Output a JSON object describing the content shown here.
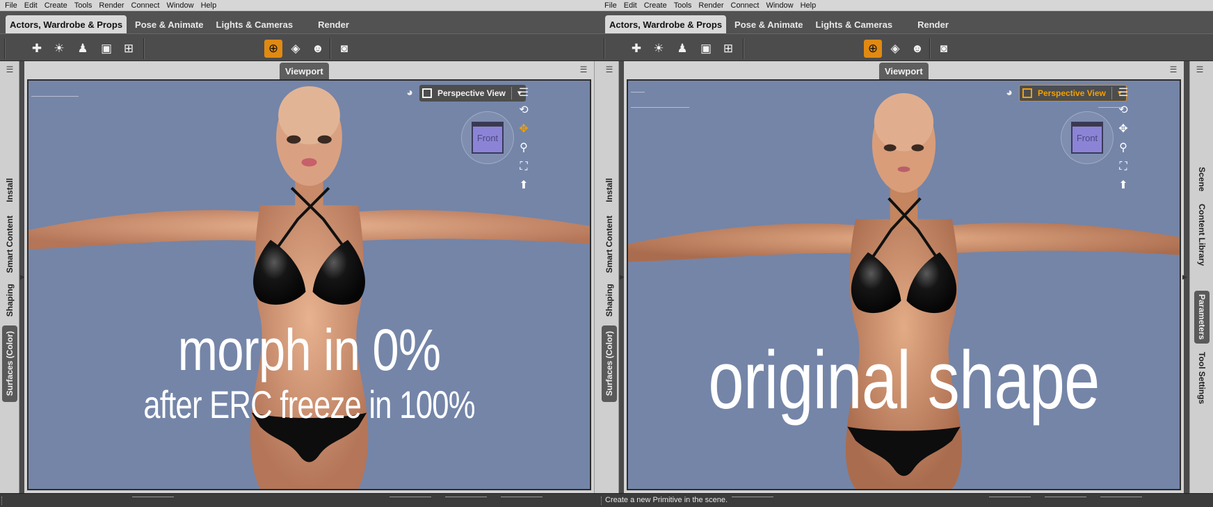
{
  "menu": [
    "File",
    "Edit",
    "Create",
    "Tools",
    "Render",
    "Connect",
    "Window",
    "Help"
  ],
  "tabs": [
    {
      "label": "Actors, Wardrobe & Props",
      "active": true
    },
    {
      "label": "Pose & Animate",
      "active": false
    },
    {
      "label": "Lights & Cameras",
      "active": false
    },
    {
      "label": "Render",
      "active": false
    }
  ],
  "toolbar_icons": [
    "create-primitive-icon",
    "create-light-icon",
    "create-figure-icon",
    "create-camera-icon",
    "create-null-icon",
    "universal-tool-icon",
    "surface-selection-icon",
    "node-weight-brush-icon",
    "render-camera-icon"
  ],
  "viewport_tab": "Viewport",
  "view_dropdown": "Perspective View",
  "cube_label": "Front",
  "left_sidebar_tabs": [
    "Install",
    "Smart Content",
    "Shaping",
    "Surfaces (Color)"
  ],
  "right_sidebar_tabs": [
    "Scene",
    "Content Library",
    "Parameters",
    "Tool Settings"
  ],
  "overlay": {
    "left_line1": "morph in 0%",
    "left_line2": "after ERC freeze in 100%",
    "right": "original shape"
  },
  "status_text": "Create a new Primitive in the scene.",
  "colors": {
    "viewport_bg": "#7485a8",
    "accent_orange": "#e08a12",
    "panel_bg": "#d3d3d3"
  }
}
